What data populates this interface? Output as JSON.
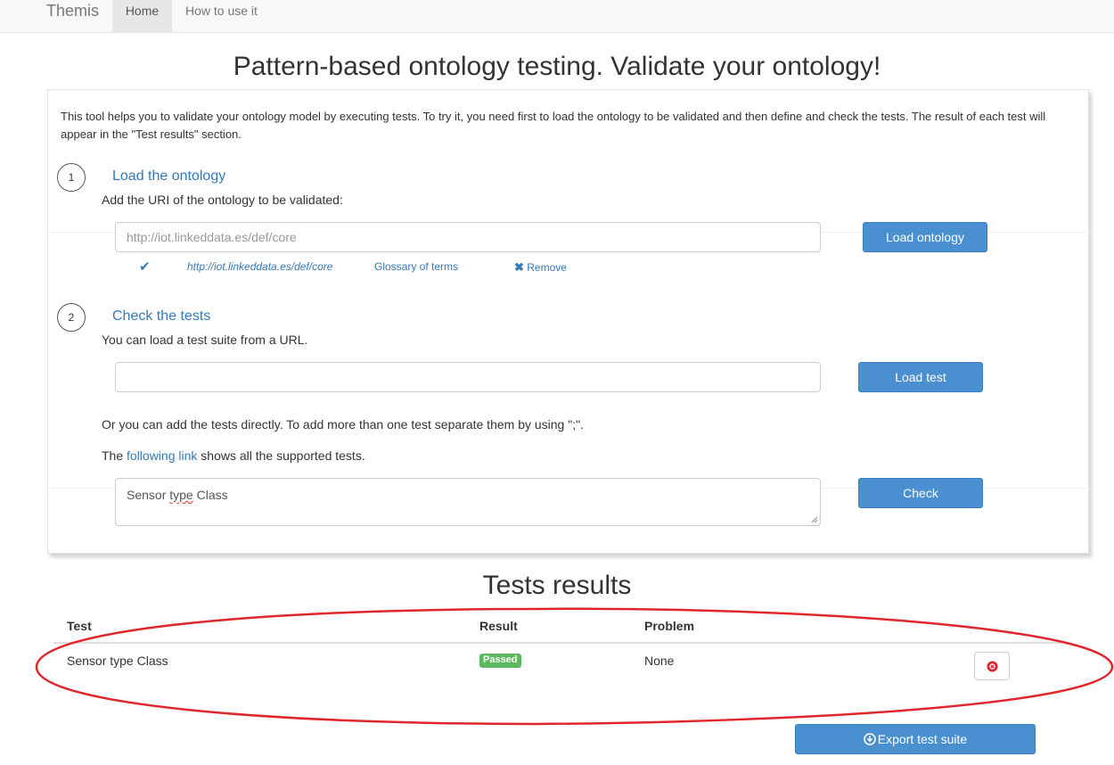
{
  "navbar": {
    "brand": "Themis",
    "tabs": [
      {
        "label": "Home",
        "active": true
      },
      {
        "label": "How to use it",
        "active": false
      }
    ]
  },
  "page_title": "Pattern-based ontology testing. Validate your ontology!",
  "intro": "This tool helps you to validate your ontology model by executing tests. To try it, you need first to load the ontology to be validated and then define and check the tests. The result of each test will appear in the \"Test results\" section.",
  "step1": {
    "number": "1",
    "title": "Load the ontology",
    "instruction": "Add the URI of the ontology to be validated:",
    "input_placeholder": "http://iot.linkeddata.es/def/core",
    "button": "Load ontology",
    "loaded": {
      "uri": "http://iot.linkeddata.es/def/core",
      "glossary": "Glossary of terms",
      "remove": "Remove"
    }
  },
  "step2": {
    "number": "2",
    "title": "Check the tests",
    "instruction": "You can load a test suite from a URL.",
    "url_input_value": "",
    "load_button": "Load test",
    "direct_text": "Or you can add the tests directly. To add more than one test separate them by using \";\".",
    "link_prefix": "The ",
    "link_text": "following link",
    "link_suffix": " shows all the supported tests.",
    "tests_text": {
      "w1": "Sensor ",
      "w2": "type",
      "w3": " Class"
    },
    "check_button": "Check"
  },
  "results": {
    "title": "Tests results",
    "columns": {
      "test": "Test",
      "result": "Result",
      "problem": "Problem"
    },
    "rows": [
      {
        "test": "Sensor type Class",
        "result": "Passed",
        "problem": "None"
      }
    ],
    "export_button": "Export test suite"
  },
  "colors": {
    "primary": "#4a8fd0",
    "link": "#337ab7",
    "success": "#5cb85c",
    "annotation": "#e0262b"
  }
}
